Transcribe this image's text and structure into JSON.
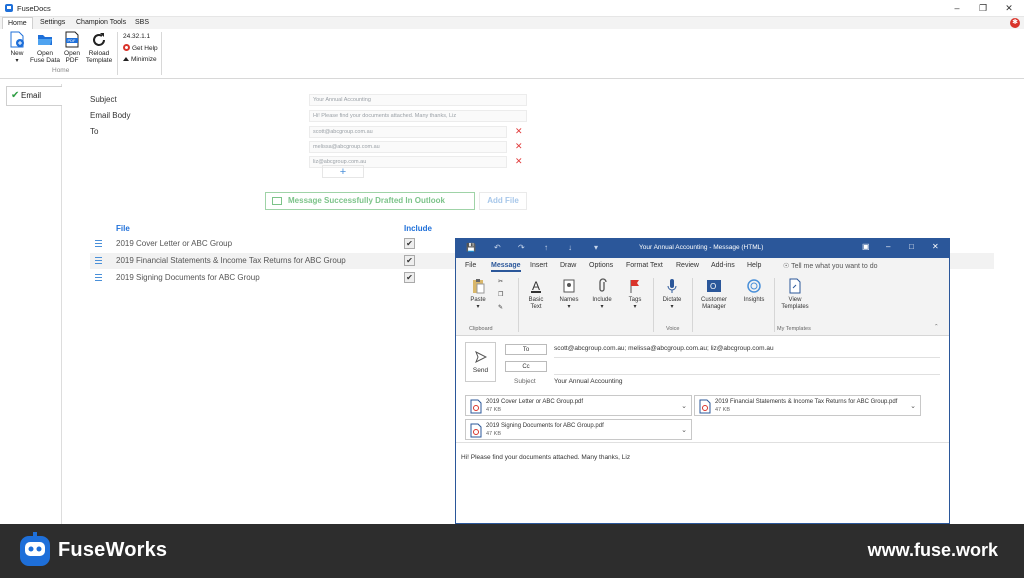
{
  "fusedocs": {
    "window_title": "FuseDocs",
    "menu_tabs": [
      "Home",
      "Settings",
      "Champion Tools",
      "SBS"
    ],
    "ribbon": {
      "new_label": "New",
      "open_fuse_data_label": "Open\nFuse Data",
      "open_pdf_label": "Open\nPDF",
      "reload_template_label": "Reload\nTemplate",
      "group_label": "Home",
      "version": "24.32.1.1",
      "get_help_label": "Get Help",
      "minimize_label": "Minimize"
    },
    "sidebar_tab": "Email",
    "form": {
      "subject_label": "Subject",
      "subject_value": "Your Annual Accounting",
      "body_label": "Email Body",
      "body_value": "Hi! Please find your documents attached. Many thanks, Liz",
      "to_label": "To",
      "recipients": [
        "scott@abcgroup.com.au",
        "melissa@abcgroup.com.au",
        "liz@abcgroup.com.au"
      ],
      "add_symbol": "+"
    },
    "status_banner": "Message Successfully Drafted In Outlook",
    "add_file_label": "Add File",
    "files_table": {
      "file_header": "File",
      "include_header": "Include",
      "rows": [
        {
          "name": "2019 Cover Letter or ABC Group",
          "include": true
        },
        {
          "name": "2019 Financial Statements & Income Tax Returns for ABC Group",
          "include": true
        },
        {
          "name": "2019 Signing Documents for ABC Group",
          "include": true
        }
      ]
    }
  },
  "outlook": {
    "window_title": "Your Annual Accounting  -  Message (HTML)",
    "tabs": [
      "File",
      "Message",
      "Insert",
      "Draw",
      "Options",
      "Format Text",
      "Review",
      "Add-ins",
      "Help"
    ],
    "tell_me": "Tell me what you want to do",
    "ribbon": {
      "paste_label": "Paste",
      "clipboard_group": "Clipboard",
      "basic_text_label": "Basic\nText",
      "names_label": "Names",
      "include_label": "Include",
      "tags_label": "Tags",
      "dictate_label": "Dictate",
      "voice_group": "Voice",
      "customer_manager_label": "Customer\nManager",
      "insights_label": "Insights",
      "view_templates_label": "View\nTemplates",
      "my_templates_group": "My Templates"
    },
    "send_label": "Send",
    "to_button": "To",
    "cc_button": "Cc",
    "subject_label": "Subject",
    "to_value": "scott@abcgroup.com.au; melissa@abcgroup.com.au; liz@abcgroup.com.au",
    "subject_value": "Your Annual Accounting",
    "attachments": [
      {
        "name": "2019 Cover Letter or ABC Group.pdf",
        "size": "47 KB"
      },
      {
        "name": "2019 Financial Statements & Income Tax Returns for ABC Group.pdf",
        "size": "47 KB"
      },
      {
        "name": "2019 Signing Documents for ABC Group.pdf",
        "size": "47 KB"
      }
    ],
    "body_text": "Hi! Please find your documents attached. Many thanks, Liz"
  },
  "footer": {
    "brand": "FuseWorks",
    "url": "www.fuse.work"
  },
  "colors": {
    "accent_blue": "#1e6fd9",
    "outlook_blue": "#2b579a",
    "success_green": "#7cc389",
    "remove_red": "#e03a3a",
    "footer_dark": "#2d2d2d"
  }
}
